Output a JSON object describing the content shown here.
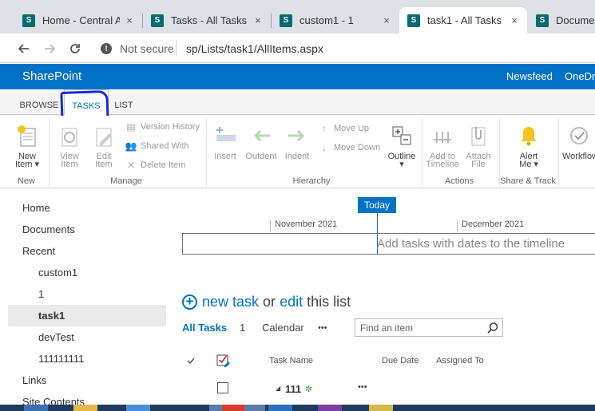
{
  "browser": {
    "tabs": [
      {
        "title": "Home - Central Ad",
        "active": false
      },
      {
        "title": "Tasks - All Tasks",
        "active": false
      },
      {
        "title": "custom1 - 1",
        "active": false
      },
      {
        "title": "task1 - All Tasks",
        "active": true
      },
      {
        "title": "Documen",
        "active": false
      }
    ],
    "security_label": "Not secure",
    "url": "sp/Lists/task1/AllItems.aspx",
    "favicon_letter": "S",
    "close_glyph": "×"
  },
  "suite": {
    "brand": "SharePoint",
    "links": [
      "Newsfeed",
      "OneDri"
    ]
  },
  "ribbon": {
    "tabs": [
      "BROWSE",
      "TASKS",
      "LIST"
    ],
    "active_tab": "TASKS",
    "annotation_color": "#1a2bd6",
    "groups": {
      "new": {
        "label": "New",
        "new_item": [
          "New",
          "Item ▾"
        ]
      },
      "manage": {
        "label": "Manage",
        "view_item": [
          "View",
          "Item"
        ],
        "edit_item": [
          "Edit",
          "Item"
        ],
        "version_history": "Version History",
        "shared_with": "Shared With",
        "delete_item": "Delete Item"
      },
      "hierarchy": {
        "label": "Hierarchy",
        "insert": "Insert",
        "outdent": "Outdent",
        "indent": "Indent",
        "move_up": "Move Up",
        "move_down": "Move Down",
        "outline": [
          "Outline",
          "▾"
        ]
      },
      "actions": {
        "label": "Actions",
        "add_to_timeline": [
          "Add to",
          "Timeline"
        ],
        "attach_file": [
          "Attach",
          "File"
        ]
      },
      "share_track": {
        "label": "Share & Track",
        "alert_me": [
          "Alert",
          "Me ▾"
        ]
      },
      "workflow": {
        "label": "Workflow"
      }
    }
  },
  "leftnav": {
    "items": [
      "Home",
      "Documents",
      "Recent"
    ],
    "recent": [
      "custom1",
      "1",
      "task1",
      "devTest",
      "111111111"
    ],
    "selected": "task1",
    "links": "Links",
    "site_contents": "Site Contents"
  },
  "timeline": {
    "today": "Today",
    "months": [
      "November 2021",
      "December 2021"
    ],
    "hint": "Add tasks with dates to the timeline"
  },
  "list": {
    "new_task": "new task",
    "or": "or",
    "edit": "edit",
    "this_list": "this list",
    "views": [
      "All Tasks",
      "1",
      "Calendar"
    ],
    "more": "•••",
    "search_placeholder": "Find an item",
    "columns": [
      "Task Name",
      "Due Date",
      "Assigned To"
    ],
    "rows": [
      {
        "name": "111",
        "new_marker": "✲"
      }
    ]
  },
  "colors": {
    "accent": "#0072c6",
    "suitebar": "#0072c6",
    "chrome_bg": "#dee1e6"
  }
}
